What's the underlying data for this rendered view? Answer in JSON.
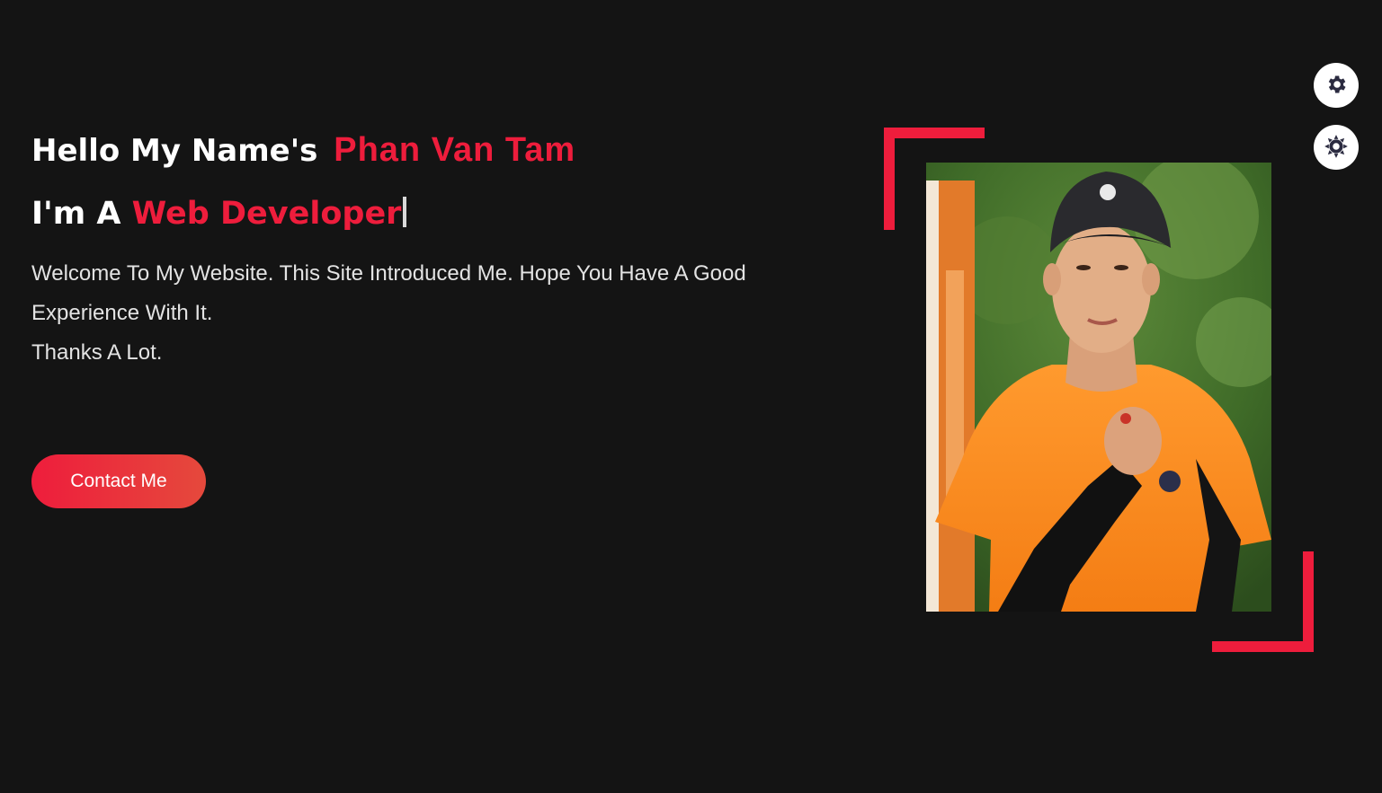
{
  "hero": {
    "greeting_prefix": "Hello My Name's",
    "name": "Phan Van Tam",
    "role_prefix": "I'm A",
    "role": "Web Developer",
    "welcome_line1": "Welcome To My Website. This Site Introduced Me. Hope You Have A Good Experience With It.",
    "welcome_line2": "Thanks A Lot.",
    "contact_label": "Contact Me"
  },
  "floating_buttons": {
    "settings_icon": "gear-icon",
    "theme_icon": "sun-icon"
  },
  "colors": {
    "background": "#141414",
    "accent": "#ee1d3c",
    "text": "#ffffff",
    "icon": "#2b2b40"
  }
}
